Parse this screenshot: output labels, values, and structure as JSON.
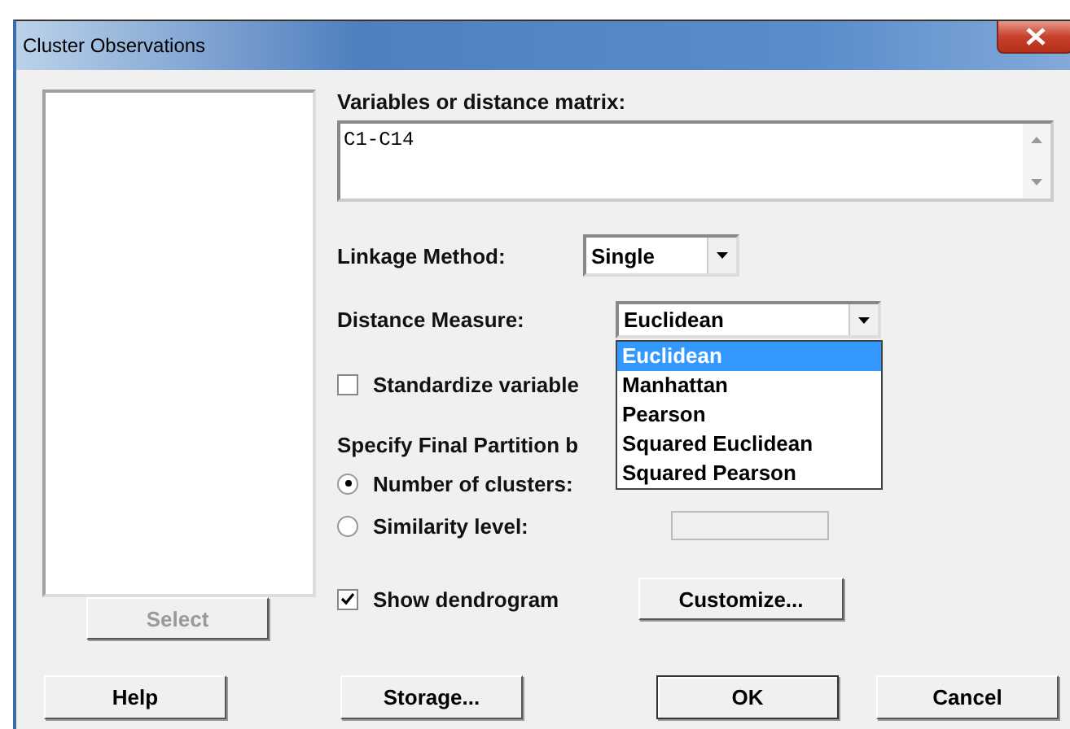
{
  "window": {
    "title": "Cluster Observations"
  },
  "select_button": {
    "label": "Select",
    "disabled": true
  },
  "variables": {
    "label": "Variables or distance matrix:",
    "value": "C1-C14"
  },
  "linkage": {
    "label": "Linkage Method:",
    "value": "Single"
  },
  "distance": {
    "label": "Distance Measure:",
    "value": "Euclidean",
    "expanded": true,
    "options": [
      {
        "label": "Euclidean",
        "selected": true
      },
      {
        "label": "Manhattan",
        "selected": false
      },
      {
        "label": "Pearson",
        "selected": false
      },
      {
        "label": "Squared Euclidean",
        "selected": false
      },
      {
        "label": "Squared Pearson",
        "selected": false
      }
    ]
  },
  "standardize": {
    "label": "Standardize variable",
    "checked": false
  },
  "partition": {
    "label": "Specify Final Partition b",
    "options": [
      {
        "label": "Number of clusters:",
        "selected": true,
        "field": false
      },
      {
        "label": "Similarity level:",
        "selected": false,
        "field": true
      }
    ]
  },
  "dendrogram": {
    "label": "Show dendrogram",
    "checked": true
  },
  "customize_button": "Customize...",
  "buttons": [
    {
      "label": "Help",
      "default": false
    },
    {
      "label": "Storage...",
      "default": false
    },
    {
      "label": "OK",
      "default": true
    },
    {
      "label": "Cancel",
      "default": false
    }
  ]
}
